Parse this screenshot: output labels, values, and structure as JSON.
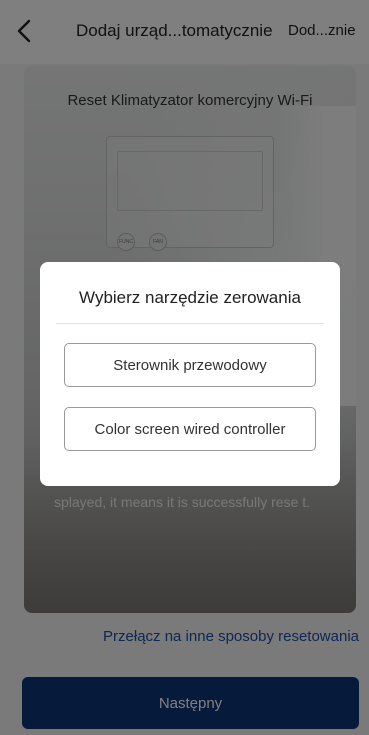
{
  "header": {
    "title": "Dodaj urząd...tomatycznie",
    "action_label": "Dod...znie",
    "back_icon": "chevron-left-icon"
  },
  "card": {
    "heading": "Reset Klimatyzator komercyjny Wi-Fi",
    "controller_buttons": [
      "FUNC",
      "FAN"
    ],
    "description": "splayed, it means it is successfully rese t."
  },
  "switch_link": "Przełącz na inne sposoby resetowania",
  "next_button": "Następny",
  "dialog": {
    "title": "Wybierz narzędzie zerowania",
    "options": [
      "Sterownik przewodowy",
      "Color screen wired controller"
    ]
  },
  "colors": {
    "primary_button": "#0c3576",
    "link": "#1f4fa3",
    "overlay": "rgba(0,0,0,0.5)"
  }
}
